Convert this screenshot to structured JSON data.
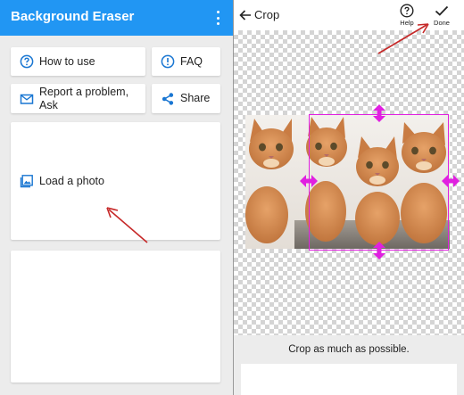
{
  "left": {
    "app_title": "Background Eraser",
    "menu_icon": "kebab-menu-icon",
    "cards": {
      "how_to_use": {
        "label": "How to use",
        "icon": "help-circle-icon"
      },
      "faq": {
        "label": "FAQ",
        "icon": "alert-circle-icon"
      },
      "report": {
        "label_line1": "Report a problem,",
        "label_line2": "Ask",
        "icon": "email-icon"
      },
      "share": {
        "label": "Share",
        "icon": "share-icon"
      },
      "load_photo": {
        "label": "Load a photo",
        "icon": "photo-icon"
      }
    }
  },
  "right": {
    "title": "Crop",
    "help_label": "Help",
    "done_label": "Done",
    "hint": "Crop as much as possible."
  },
  "colors": {
    "appbar": "#2196f3",
    "icon_blue": "#1976d2",
    "crop_frame": "#e020e0",
    "annotation_arrow": "#c62828"
  }
}
